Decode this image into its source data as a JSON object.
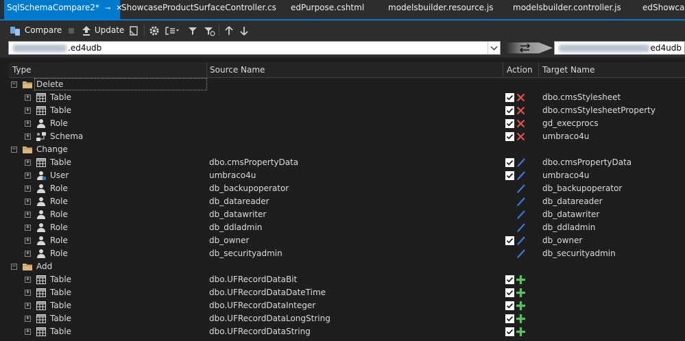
{
  "tabs": [
    {
      "label": "SqlSchemaCompare2*",
      "active": true
    },
    {
      "label": "ShowcaseProductSurfaceController.cs",
      "active": false
    },
    {
      "label": "edPurpose.cshtml",
      "active": false
    },
    {
      "label": "modelsbuilder.resource.js",
      "active": false
    },
    {
      "label": "modelsbuilder.controller.js",
      "active": false
    },
    {
      "label": "edShowcase",
      "active": false
    }
  ],
  "toolbar": {
    "compare_label": "Compare",
    "update_label": "Update",
    "icons": [
      "compare-icon",
      "stop-icon",
      "update-icon",
      "script-icon",
      "settings-icon",
      "group-by-icon",
      "filter-icon",
      "clear-filter-icon",
      "previous-icon",
      "next-icon"
    ]
  },
  "connection": {
    "source_value": ".ed4udb",
    "target_value": "ed4udb"
  },
  "columns": {
    "type": "Type",
    "source": "Source Name",
    "action": "Action",
    "target": "Target Name"
  },
  "groups": [
    {
      "label": "Delete",
      "rows": [
        {
          "type": "Table",
          "icon": "table-icon",
          "source": "",
          "checked": true,
          "action": "delete",
          "target": "dbo.cmsStylesheet"
        },
        {
          "type": "Table",
          "icon": "table-icon",
          "source": "",
          "checked": true,
          "action": "delete",
          "target": "dbo.cmsStylesheetProperty"
        },
        {
          "type": "Role",
          "icon": "role-icon",
          "source": "",
          "checked": true,
          "action": "delete",
          "target": "gd_execprocs"
        },
        {
          "type": "Schema",
          "icon": "schema-icon",
          "source": "",
          "checked": true,
          "action": "delete",
          "target": "umbraco4u"
        }
      ]
    },
    {
      "label": "Change",
      "rows": [
        {
          "type": "Table",
          "icon": "table-icon",
          "source": "dbo.cmsPropertyData",
          "checked": true,
          "action": "change",
          "target": "dbo.cmsPropertyData"
        },
        {
          "type": "User",
          "icon": "user-icon",
          "source": "umbraco4u",
          "checked": true,
          "action": "change",
          "target": "umbraco4u"
        },
        {
          "type": "Role",
          "icon": "role-icon",
          "source": "db_backupoperator",
          "checked": false,
          "action": "change",
          "target": "db_backupoperator"
        },
        {
          "type": "Role",
          "icon": "role-icon",
          "source": "db_datareader",
          "checked": false,
          "action": "change",
          "target": "db_datareader"
        },
        {
          "type": "Role",
          "icon": "role-icon",
          "source": "db_datawriter",
          "checked": false,
          "action": "change",
          "target": "db_datawriter"
        },
        {
          "type": "Role",
          "icon": "role-icon",
          "source": "db_ddladmin",
          "checked": false,
          "action": "change",
          "target": "db_ddladmin"
        },
        {
          "type": "Role",
          "icon": "role-icon",
          "source": "db_owner",
          "checked": true,
          "action": "change",
          "target": "db_owner"
        },
        {
          "type": "Role",
          "icon": "role-icon",
          "source": "db_securityadmin",
          "checked": false,
          "action": "change",
          "target": "db_securityadmin"
        }
      ]
    },
    {
      "label": "Add",
      "rows": [
        {
          "type": "Table",
          "icon": "table-icon",
          "source": "dbo.UFRecordDataBit",
          "checked": true,
          "action": "add",
          "target": ""
        },
        {
          "type": "Table",
          "icon": "table-icon",
          "source": "dbo.UFRecordDataDateTime",
          "checked": true,
          "action": "add",
          "target": ""
        },
        {
          "type": "Table",
          "icon": "table-icon",
          "source": "dbo.UFRecordDataInteger",
          "checked": true,
          "action": "add",
          "target": ""
        },
        {
          "type": "Table",
          "icon": "table-icon",
          "source": "dbo.UFRecordDataLongString",
          "checked": true,
          "action": "add",
          "target": ""
        },
        {
          "type": "Table",
          "icon": "table-icon",
          "source": "dbo.UFRecordDataString",
          "checked": true,
          "action": "add",
          "target": ""
        }
      ]
    }
  ],
  "colors": {
    "accent": "#007acc",
    "delete": "#e05252",
    "change": "#3d7bd9",
    "add": "#5cc35c",
    "folder": "#dcb67a"
  }
}
